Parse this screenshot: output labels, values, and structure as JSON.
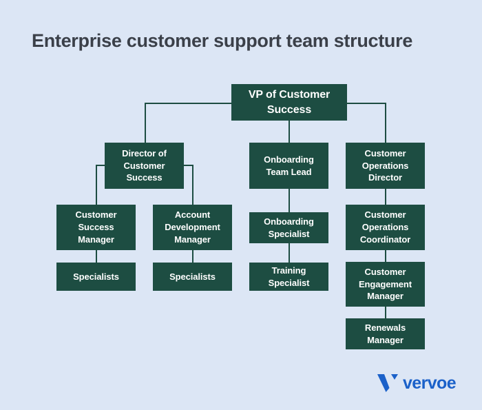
{
  "page": {
    "title": "Enterprise customer support team structure",
    "background_color": "#dce6f5",
    "title_color": "#3b4049",
    "node_fill_color": "#1d4d42",
    "node_text_color": "#ffffff",
    "connector_color": "#1d4d42"
  },
  "chart_data": {
    "type": "diagram",
    "subtype": "org-chart",
    "title": "Enterprise customer support team structure",
    "orientation": "top-down",
    "levels": 5,
    "node_count": 13,
    "nodes": [
      {
        "id": "vp",
        "label": "VP of Customer Success",
        "level": 0,
        "parent": null
      },
      {
        "id": "dir_cs",
        "label": "Director of Customer Success",
        "level": 1,
        "parent": "vp"
      },
      {
        "id": "onb_lead",
        "label": "Onboarding Team Lead",
        "level": 1,
        "parent": "vp"
      },
      {
        "id": "cust_ops_dir",
        "label": "Customer Operations Director",
        "level": 1,
        "parent": "vp"
      },
      {
        "id": "csm",
        "label": "Customer Success Manager",
        "level": 2,
        "parent": "dir_cs"
      },
      {
        "id": "adm",
        "label": "Account Development Manager",
        "level": 2,
        "parent": "dir_cs"
      },
      {
        "id": "onb_spec",
        "label": "Onboarding Specialist",
        "level": 2,
        "parent": "onb_lead"
      },
      {
        "id": "cust_ops_coord",
        "label": "Customer Operations Coordinator",
        "level": 2,
        "parent": "cust_ops_dir"
      },
      {
        "id": "spec_left",
        "label": "Specialists",
        "level": 3,
        "parent": "csm"
      },
      {
        "id": "spec_right",
        "label": "Specialists",
        "level": 3,
        "parent": "adm"
      },
      {
        "id": "train_spec",
        "label": "Training Specialist",
        "level": 3,
        "parent": "onb_spec"
      },
      {
        "id": "cust_eng_mgr",
        "label": "Customer Engagement Manager",
        "level": 3,
        "parent": "cust_ops_coord"
      },
      {
        "id": "renew_mgr",
        "label": "Renewals Manager",
        "level": 4,
        "parent": "cust_eng_mgr"
      }
    ],
    "edges": [
      {
        "from": "vp",
        "to": "dir_cs"
      },
      {
        "from": "vp",
        "to": "onb_lead"
      },
      {
        "from": "vp",
        "to": "cust_ops_dir"
      },
      {
        "from": "dir_cs",
        "to": "csm"
      },
      {
        "from": "dir_cs",
        "to": "adm"
      },
      {
        "from": "onb_lead",
        "to": "onb_spec"
      },
      {
        "from": "cust_ops_dir",
        "to": "cust_ops_coord"
      },
      {
        "from": "csm",
        "to": "spec_left"
      },
      {
        "from": "adm",
        "to": "spec_right"
      },
      {
        "from": "onb_spec",
        "to": "train_spec"
      },
      {
        "from": "cust_ops_coord",
        "to": "cust_eng_mgr"
      },
      {
        "from": "cust_eng_mgr",
        "to": "renew_mgr"
      }
    ]
  },
  "branding": {
    "wordmark": "vervoe",
    "logo_color": "#1b61c9",
    "mark_name": "vervoe-v-mark"
  }
}
